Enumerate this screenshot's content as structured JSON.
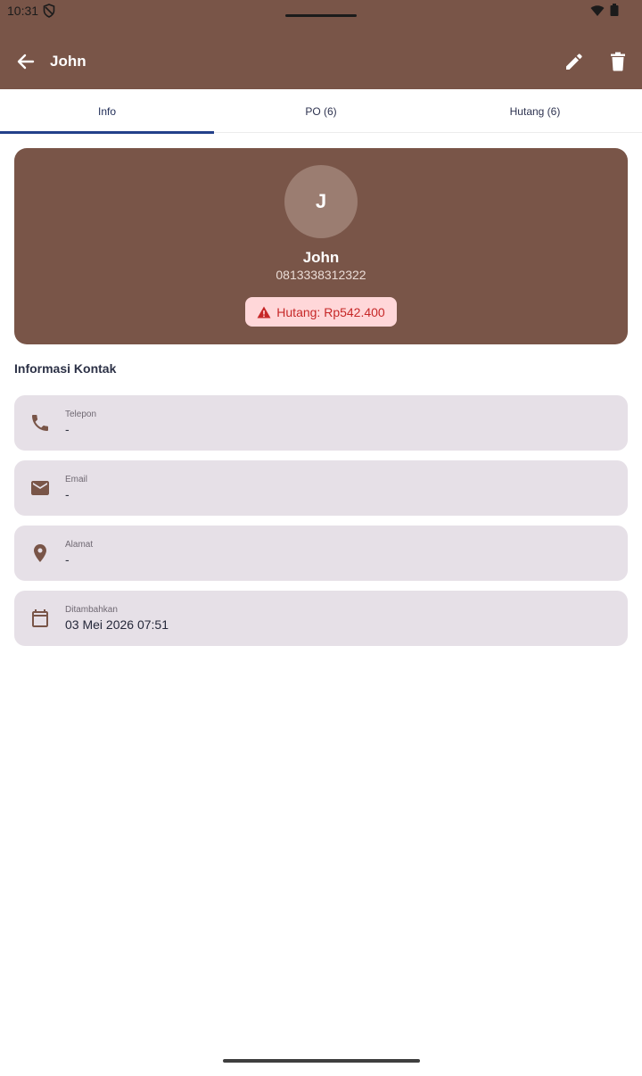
{
  "status_bar": {
    "time": "10:31"
  },
  "header": {
    "title": "John"
  },
  "tabs": [
    {
      "label": "Info"
    },
    {
      "label": "PO (6)"
    },
    {
      "label": "Hutang (6)"
    }
  ],
  "profile": {
    "initial": "J",
    "name": "John",
    "phone": "0813338312322",
    "debt_label": "Hutang: Rp542.400"
  },
  "contact_section": {
    "title": "Informasi Kontak",
    "items": [
      {
        "label": "Telepon",
        "value": "-",
        "icon": "phone-icon"
      },
      {
        "label": "Email",
        "value": "-",
        "icon": "email-icon"
      },
      {
        "label": "Alamat",
        "value": "-",
        "icon": "location-pin-icon"
      },
      {
        "label": "Ditambahkan",
        "value": "03 Mei 2026 07:51",
        "icon": "calendar-icon"
      }
    ]
  },
  "colors": {
    "primary": "#795548",
    "tab_indicator": "#23408a",
    "debt_badge_bg": "#ffd7d9",
    "debt_badge_text": "#c62828",
    "info_row_bg": "#e6e0e7"
  }
}
